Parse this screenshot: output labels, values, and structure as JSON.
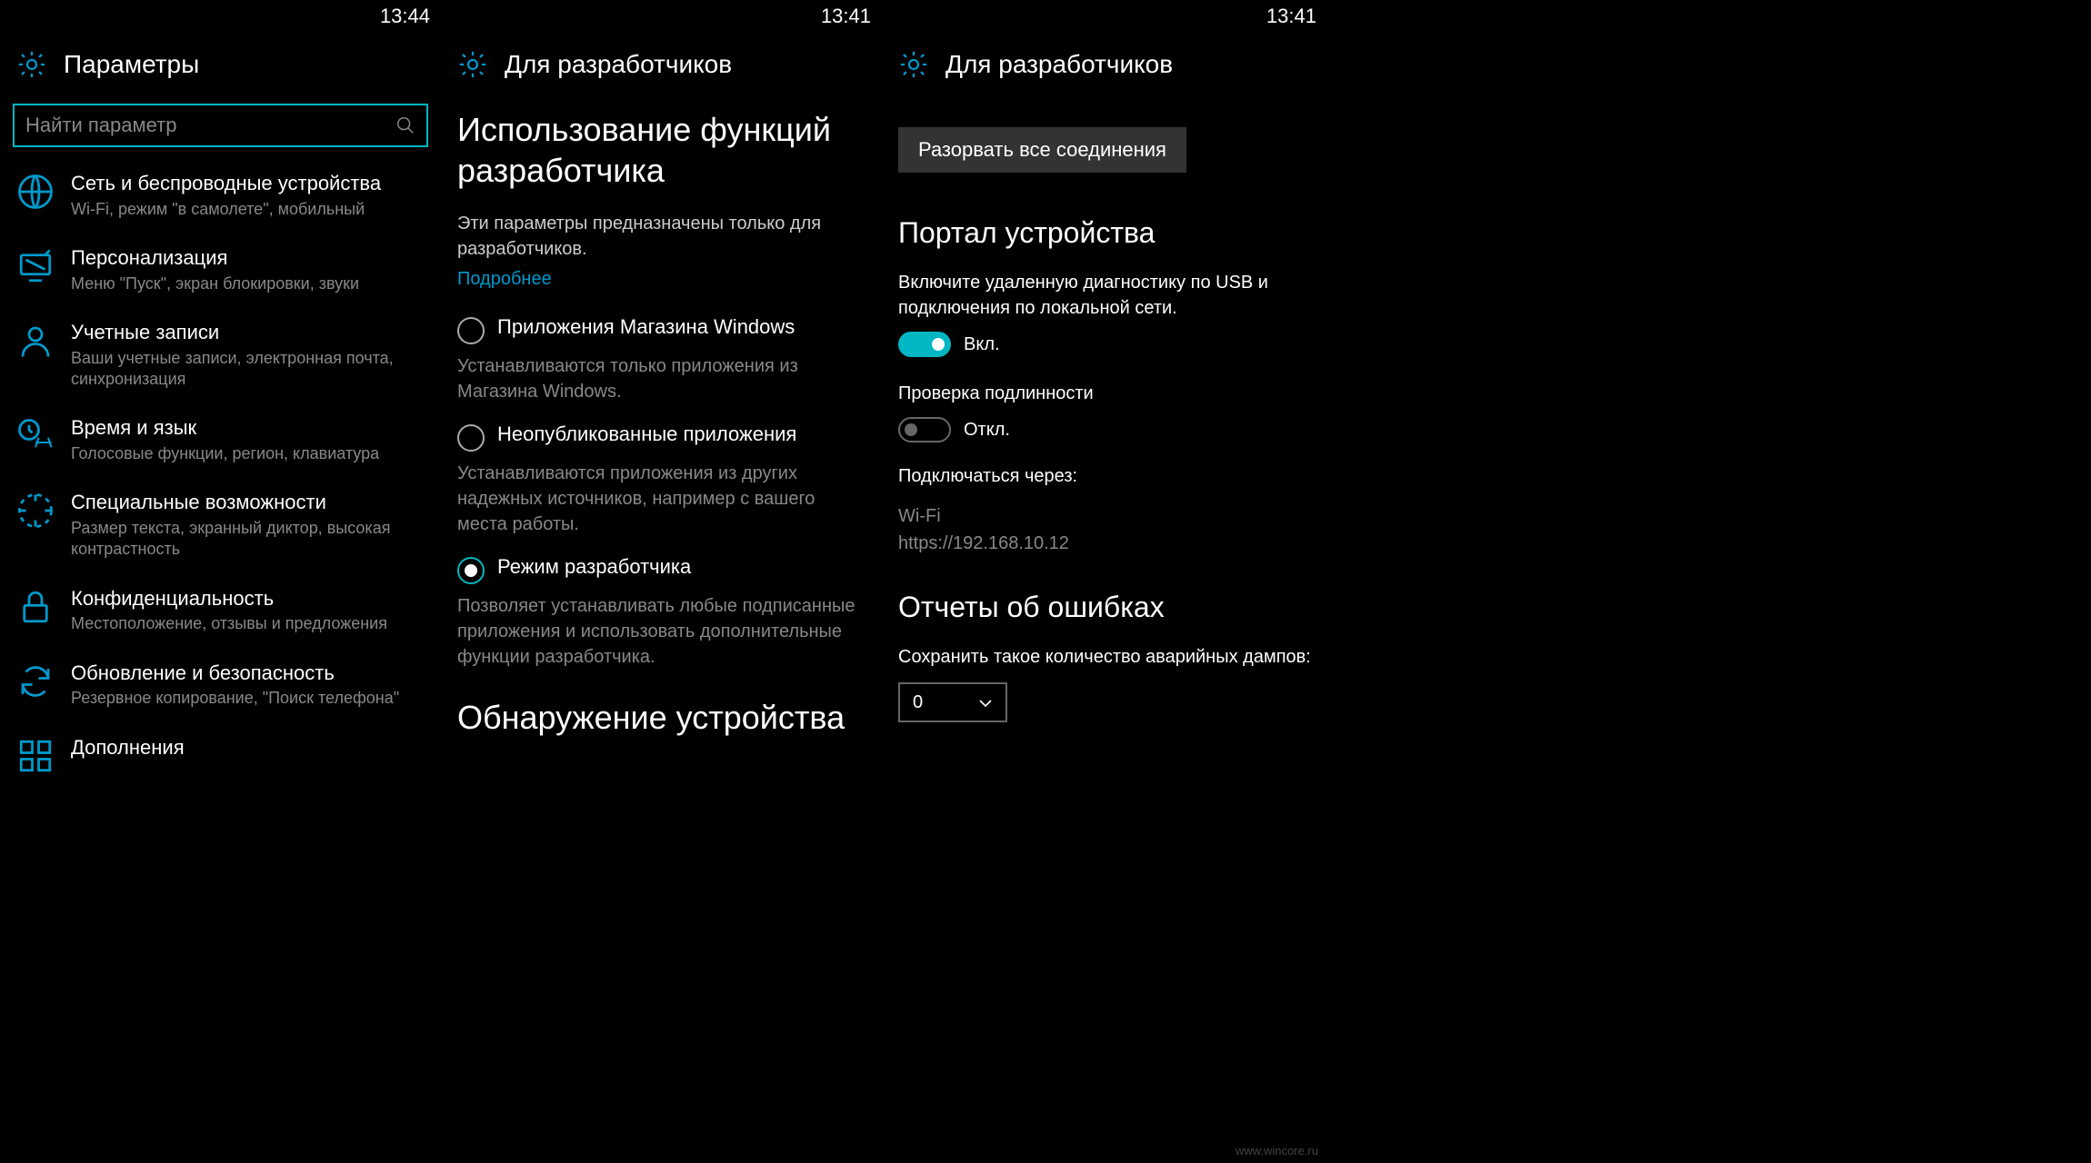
{
  "screen1": {
    "status_time": "13:44",
    "title": "Параметры",
    "search_placeholder": "Найти параметр",
    "items": [
      {
        "label": "Сеть и беспроводные устройства",
        "desc": "Wi-Fi, режим \"в самолете\", мобильный"
      },
      {
        "label": "Персонализация",
        "desc": "Меню \"Пуск\", экран блокировки, звуки"
      },
      {
        "label": "Учетные записи",
        "desc": "Ваши учетные записи, электронная почта, синхронизация"
      },
      {
        "label": "Время и язык",
        "desc": "Голосовые функции, регион, клавиатура"
      },
      {
        "label": "Специальные возможности",
        "desc": "Размер текста, экранный диктор, высокая контрастность"
      },
      {
        "label": "Конфиденциальность",
        "desc": "Местоположение, отзывы и предложения"
      },
      {
        "label": "Обновление и безопасность",
        "desc": "Резервное копирование, \"Поиск телефона\""
      },
      {
        "label": "Дополнения",
        "desc": ""
      }
    ]
  },
  "screen2": {
    "status_time": "13:41",
    "title": "Для разработчиков",
    "heading": "Использование функций разработчика",
    "intro": "Эти параметры предназначены только для разработчиков.",
    "link": "Подробнее",
    "options": [
      {
        "label": "Приложения Магазина Windows",
        "desc": "Устанавливаются только приложения из Магазина Windows.",
        "selected": false
      },
      {
        "label": "Неопубликованные приложения",
        "desc": "Устанавливаются приложения из других надежных источников, например с вашего места работы.",
        "selected": false
      },
      {
        "label": "Режим разработчика",
        "desc": "Позволяет устанавливать любые подписанные приложения и использовать дополнительные функции разработчика.",
        "selected": true
      }
    ],
    "heading2": "Обнаружение устройства"
  },
  "screen3": {
    "status_time": "13:41",
    "title": "Для разработчиков",
    "disconnect_btn": "Разорвать все соединения",
    "portal_heading": "Портал устройства",
    "portal_desc": "Включите удаленную диагностику по USB и подключения по локальной сети.",
    "portal_toggle_on": true,
    "portal_toggle_label": "Вкл.",
    "auth_heading": "Проверка подлинности",
    "auth_toggle_on": false,
    "auth_toggle_label": "Откл.",
    "connect_via_heading": "Подключаться через:",
    "connect_via_value1": "Wi-Fi",
    "connect_via_value2": "https://192.168.10.12",
    "crash_heading": "Отчеты об ошибках",
    "crash_label": "Сохранить такое количество аварийных дампов:",
    "crash_value": "0"
  },
  "watermark": "www.wincore.ru"
}
